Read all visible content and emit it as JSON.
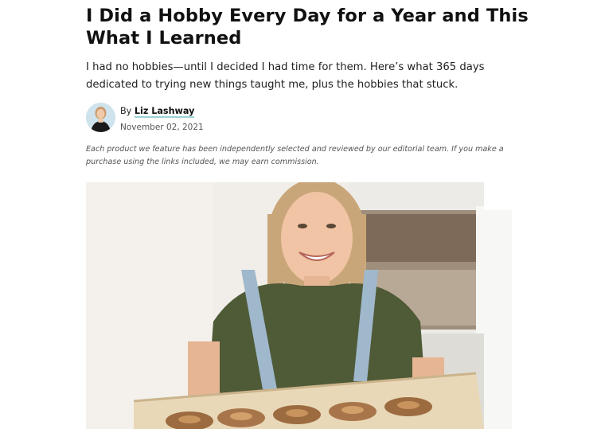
{
  "article": {
    "headline": "I Did a Hobby Every Day for a Year and This What I Learned",
    "dek": "I had no hobbies—until I decided I had time for them. Here’s what 365 days dedicated to trying new things taught me, plus the hobbies that stuck.",
    "byline_prefix": "By",
    "author": "Liz Lashway",
    "date": "November 02, 2021",
    "disclaimer": "Each product we feature has been independently selected and reviewed by our editorial team. If you make a purchase using the links included, we may earn commission."
  },
  "colors": {
    "author_underline": "#9ad3d6",
    "avatar_bg": "#cfe3ec"
  },
  "images": {
    "avatar": "author-headshot",
    "hero": "woman-holding-tray-of-cinnamon-rolls"
  }
}
